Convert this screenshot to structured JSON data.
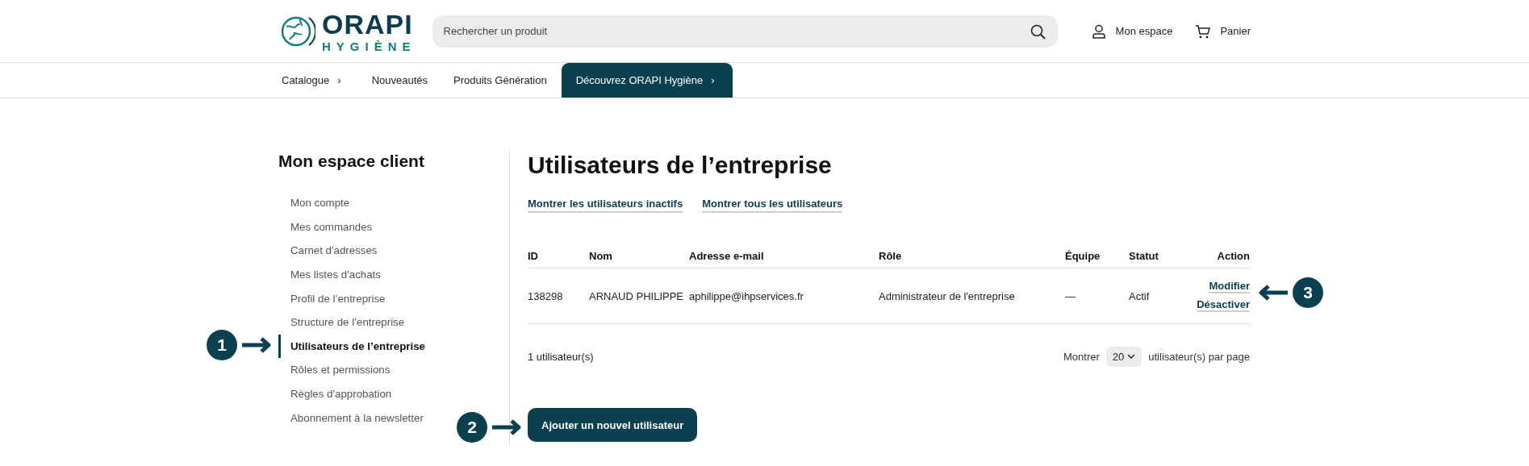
{
  "header": {
    "logo": {
      "name": "ORAPI",
      "tagline": "HYGIÈNE"
    },
    "search": {
      "placeholder": "Rechercher un produit"
    },
    "account": "Mon espace",
    "cart": "Panier"
  },
  "nav": [
    {
      "label": "Catalogue",
      "chevron": "›",
      "selected": false
    },
    {
      "label": "Nouveautés",
      "selected": false
    },
    {
      "label": "Produits Génération",
      "selected": false
    },
    {
      "label": "Découvrez ORAPI Hygiène",
      "chevron": "›",
      "selected": true
    }
  ],
  "sidebar": {
    "title": "Mon espace client",
    "items": [
      {
        "label": "Mon compte",
        "selected": false
      },
      {
        "label": "Mes commandes",
        "selected": false
      },
      {
        "label": "Carnet d'adresses",
        "selected": false
      },
      {
        "label": "Mes listes d'achats",
        "selected": false
      },
      {
        "label": "Profil de l’entreprise",
        "selected": false
      },
      {
        "label": "Structure de l’entreprise",
        "selected": false
      },
      {
        "label": "Utilisateurs de l’entreprise",
        "selected": true
      },
      {
        "label": "Rôles et permissions",
        "selected": false
      },
      {
        "label": "Règles d'approbation",
        "selected": false
      },
      {
        "label": "Abonnement à la newsletter",
        "selected": false
      }
    ]
  },
  "main": {
    "title": "Utilisateurs de l’entreprise",
    "filters": [
      "Montrer les utilisateurs inactifs",
      "Montrer tous les utilisateurs"
    ],
    "table": {
      "columns": [
        "ID",
        "Nom",
        "Adresse e-mail",
        "Rôle",
        "Équipe",
        "Statut",
        "Action"
      ],
      "rows": [
        {
          "cells": [
            "138298",
            "ARNAUD PHILIPPE",
            "aphilippe@ihpservices.fr",
            "Administrateur de l'entreprise",
            "—",
            "Actif"
          ],
          "actions": [
            "Modifier",
            "Désactiver"
          ]
        }
      ]
    },
    "count": "1 utilisateur(s)",
    "pager": {
      "prefix": "Montrer",
      "value": "20",
      "suffix": "utilisateur(s) par page"
    },
    "add_button": "Ajouter un nouvel utilisateur"
  },
  "annotations": [
    {
      "number": "1"
    },
    {
      "number": "2"
    },
    {
      "number": "3"
    }
  ]
}
